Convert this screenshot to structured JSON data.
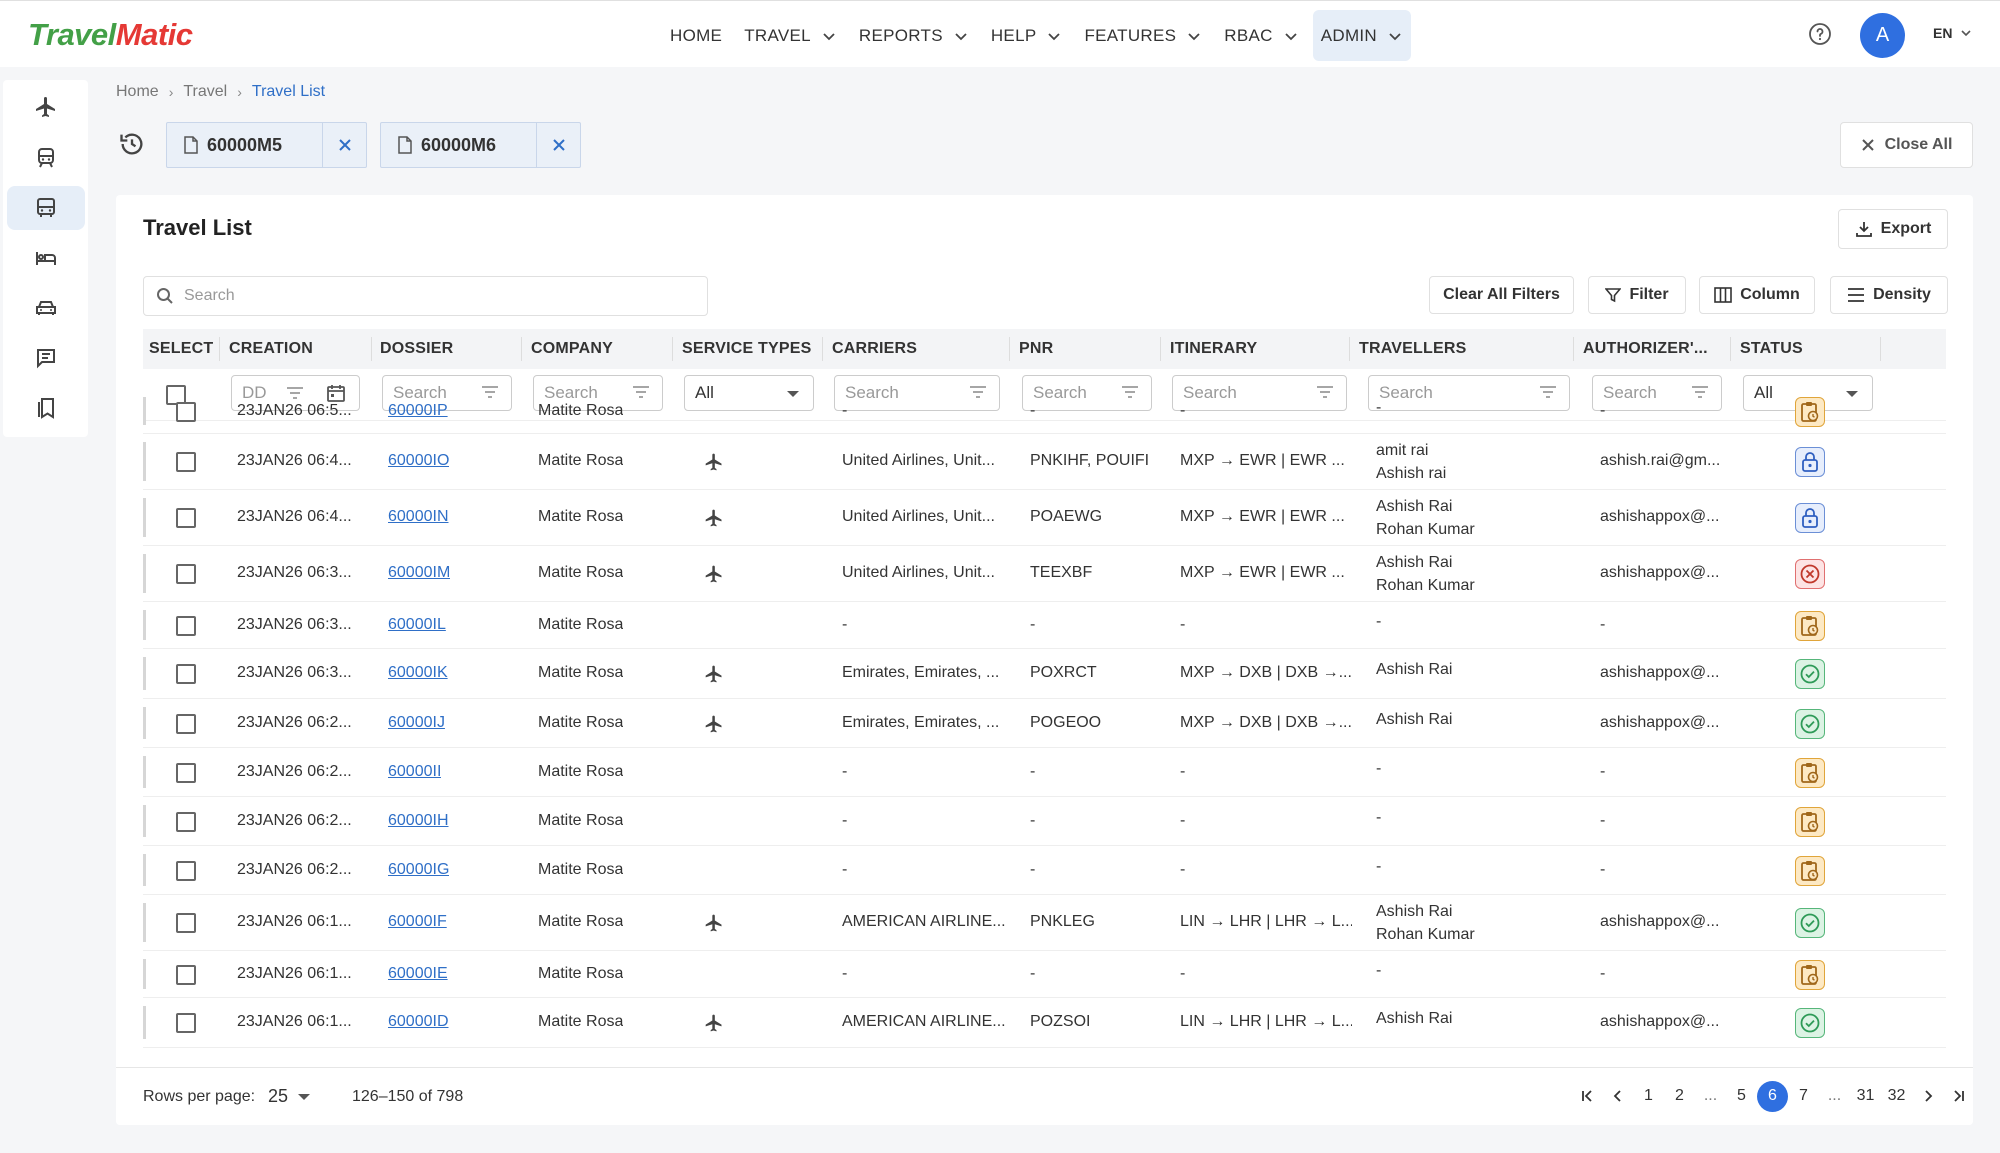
{
  "app": {
    "logo_part1": "Travel",
    "logo_part2": "Matic",
    "nav": [
      {
        "label": "HOME",
        "chevron": false
      },
      {
        "label": "TRAVEL",
        "chevron": true
      },
      {
        "label": "REPORTS",
        "chevron": true
      },
      {
        "label": "HELP",
        "chevron": true
      },
      {
        "label": "FEATURES",
        "chevron": true
      },
      {
        "label": "RBAC",
        "chevron": true
      },
      {
        "label": "ADMIN",
        "chevron": true,
        "active": true
      }
    ],
    "avatar_initial": "A",
    "language": "EN"
  },
  "rail": [
    "plane-icon",
    "train-icon",
    "bus-icon",
    "hotel-icon",
    "car-icon",
    "message-icon",
    "bookmark-icon"
  ],
  "breadcrumb": {
    "home": "Home",
    "travel": "Travel",
    "current": "Travel List"
  },
  "open_tabs": [
    {
      "label": "60000M5"
    },
    {
      "label": "60000M6"
    }
  ],
  "close_all_label": "Close All",
  "card": {
    "title": "Travel List",
    "export_label": "Export",
    "search_placeholder": "Search",
    "clear_filters_label": "Clear All Filters",
    "filter_label": "Filter",
    "column_label": "Column",
    "density_label": "Density"
  },
  "columns": [
    "SELECT",
    "CREATION",
    "DOSSIER",
    "COMPANY",
    "SERVICE TYPES",
    "CARRIERS",
    "PNR",
    "ITINERARY",
    "TRAVELLERS",
    "AUTHORIZER'...",
    "STATUS"
  ],
  "filters": {
    "creation_placeholder": "DD",
    "search_placeholder": "Search",
    "service_value": "All",
    "status_value": "All"
  },
  "rows": [
    {
      "creation": "23JAN26 06:5...",
      "dossier": "60000IP",
      "company": "Matite Rosa",
      "air": false,
      "carriers": "-",
      "pnr": "-",
      "itinerary": "-",
      "travellers": [
        "-"
      ],
      "authorizer": "-",
      "status": "pending"
    },
    {
      "creation": "23JAN26 06:4...",
      "dossier": "60000IO",
      "company": "Matite Rosa",
      "air": true,
      "carriers": "United Airlines, Unit...",
      "pnr": "PNKIHF, POUIFI",
      "itinerary": "MXP → EWR | EWR ...",
      "travellers": [
        "amit rai",
        "Ashish rai"
      ],
      "authorizer": "ashish.rai@gm...",
      "status": "locked"
    },
    {
      "creation": "23JAN26 06:4...",
      "dossier": "60000IN",
      "company": "Matite Rosa",
      "air": true,
      "carriers": "United Airlines, Unit...",
      "pnr": "POAEWG",
      "itinerary": "MXP → EWR | EWR ...",
      "travellers": [
        "Ashish Rai",
        "Rohan Kumar"
      ],
      "authorizer": "ashishappox@...",
      "status": "locked"
    },
    {
      "creation": "23JAN26 06:3...",
      "dossier": "60000IM",
      "company": "Matite Rosa",
      "air": true,
      "carriers": "United Airlines, Unit...",
      "pnr": "TEEXBF",
      "itinerary": "MXP → EWR | EWR ...",
      "travellers": [
        "Ashish Rai",
        "Rohan Kumar"
      ],
      "authorizer": "ashishappox@...",
      "status": "cancel"
    },
    {
      "creation": "23JAN26 06:3...",
      "dossier": "60000IL",
      "company": "Matite Rosa",
      "air": false,
      "carriers": "-",
      "pnr": "-",
      "itinerary": "-",
      "travellers": [
        "-"
      ],
      "authorizer": "-",
      "status": "pending"
    },
    {
      "creation": "23JAN26 06:3...",
      "dossier": "60000IK",
      "company": "Matite Rosa",
      "air": true,
      "carriers": "Emirates, Emirates, ...",
      "pnr": "POXRCT",
      "itinerary": "MXP → DXB | DXB →...",
      "travellers": [
        "Ashish Rai"
      ],
      "authorizer": "ashishappox@...",
      "status": "ok"
    },
    {
      "creation": "23JAN26 06:2...",
      "dossier": "60000IJ",
      "company": "Matite Rosa",
      "air": true,
      "carriers": "Emirates, Emirates, ...",
      "pnr": "POGEOO",
      "itinerary": "MXP → DXB | DXB →...",
      "travellers": [
        "Ashish Rai"
      ],
      "authorizer": "ashishappox@...",
      "status": "ok"
    },
    {
      "creation": "23JAN26 06:2...",
      "dossier": "60000II",
      "company": "Matite Rosa",
      "air": false,
      "carriers": "-",
      "pnr": "-",
      "itinerary": "-",
      "travellers": [
        "-"
      ],
      "authorizer": "-",
      "status": "pending"
    },
    {
      "creation": "23JAN26 06:2...",
      "dossier": "60000IH",
      "company": "Matite Rosa",
      "air": false,
      "carriers": "-",
      "pnr": "-",
      "itinerary": "-",
      "travellers": [
        "-"
      ],
      "authorizer": "-",
      "status": "pending"
    },
    {
      "creation": "23JAN26 06:2...",
      "dossier": "60000IG",
      "company": "Matite Rosa",
      "air": false,
      "carriers": "-",
      "pnr": "-",
      "itinerary": "-",
      "travellers": [
        "-"
      ],
      "authorizer": "-",
      "status": "pending"
    },
    {
      "creation": "23JAN26 06:1...",
      "dossier": "60000IF",
      "company": "Matite Rosa",
      "air": true,
      "carriers": "AMERICAN AIRLINE...",
      "pnr": "PNKLEG",
      "itinerary": "LIN → LHR | LHR → L...",
      "travellers": [
        "Ashish Rai",
        "Rohan Kumar"
      ],
      "authorizer": "ashishappox@...",
      "status": "ok"
    },
    {
      "creation": "23JAN26 06:1...",
      "dossier": "60000IE",
      "company": "Matite Rosa",
      "air": false,
      "carriers": "-",
      "pnr": "-",
      "itinerary": "-",
      "travellers": [
        "-"
      ],
      "authorizer": "-",
      "status": "pending"
    },
    {
      "creation": "23JAN26 06:1...",
      "dossier": "60000ID",
      "company": "Matite Rosa",
      "air": true,
      "carriers": "AMERICAN AIRLINE...",
      "pnr": "POZSOI",
      "itinerary": "LIN → LHR | LHR → L...",
      "travellers": [
        "Ashish Rai"
      ],
      "authorizer": "ashishappox@...",
      "status": "ok"
    }
  ],
  "footer": {
    "rows_per_page_label": "Rows per page:",
    "rows_per_page": "25",
    "range": "126–150 of 798",
    "pages": [
      "1",
      "2",
      "...",
      "5",
      "6",
      "7",
      "...",
      "31",
      "32"
    ],
    "current_page": "6"
  },
  "colors": {
    "accent": "#2f6fe0",
    "link": "#2f6fc7",
    "pending": "#e0a53a",
    "ok": "#56b67a",
    "cancel": "#e07070"
  }
}
